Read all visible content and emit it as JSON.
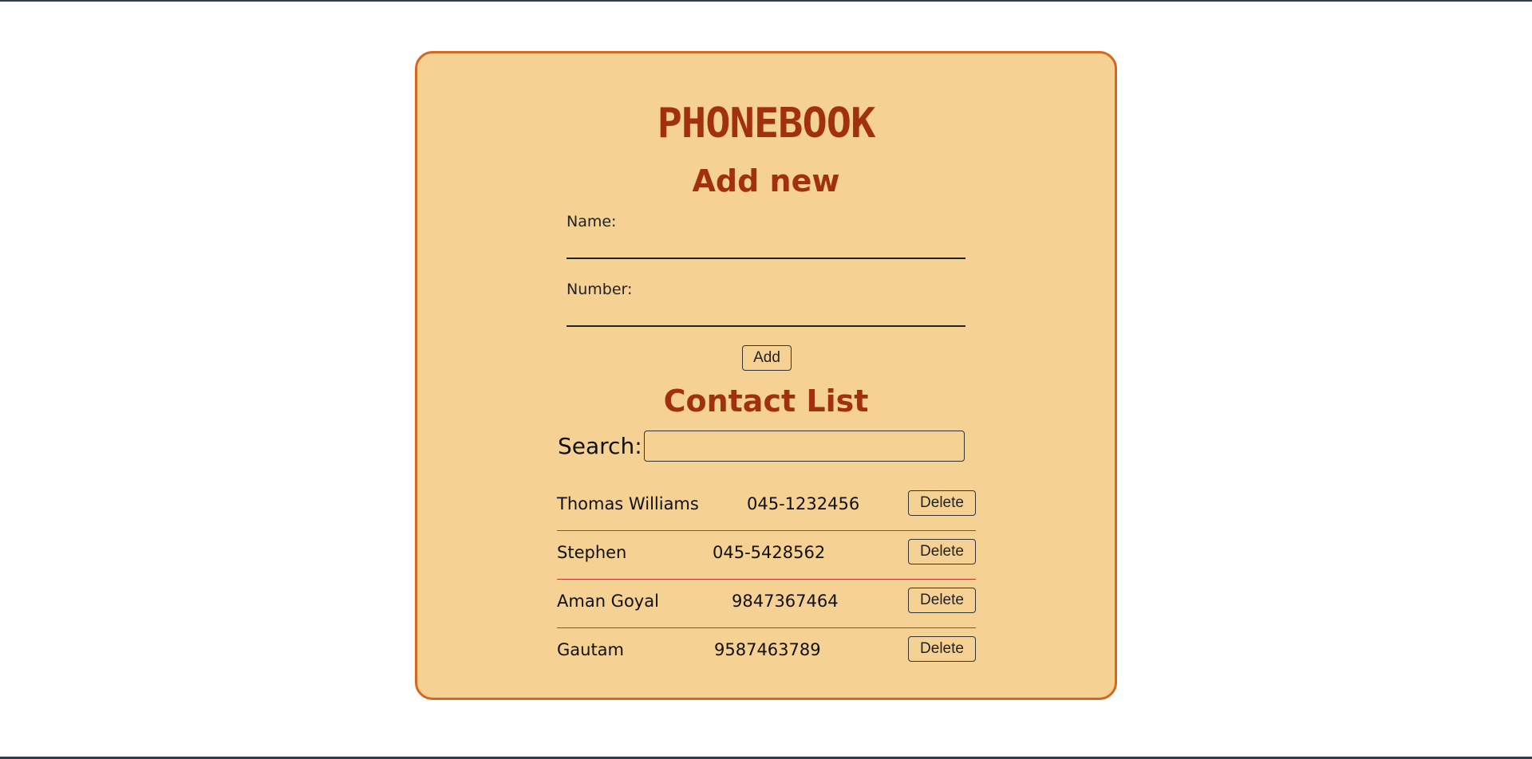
{
  "app": {
    "title": "PHONEBOOK"
  },
  "add_form": {
    "heading": "Add new",
    "name_label": "Name:",
    "name_value": "",
    "number_label": "Number:",
    "number_value": "",
    "add_button_label": "Add"
  },
  "contacts": {
    "heading": "Contact List",
    "search_label": "Search:",
    "search_value": "",
    "delete_label": "Delete",
    "items": [
      {
        "name": "Thomas Williams",
        "number": "045-1232456"
      },
      {
        "name": "Stephen",
        "number": "045-5428562"
      },
      {
        "name": "Aman Goyal",
        "number": "9847367464"
      },
      {
        "name": "Gautam",
        "number": "9587463789"
      }
    ]
  },
  "colors": {
    "card_background": "#f5d193",
    "card_border": "#d2691e",
    "heading": "#a0300e",
    "row_divider": "#c0392b"
  }
}
